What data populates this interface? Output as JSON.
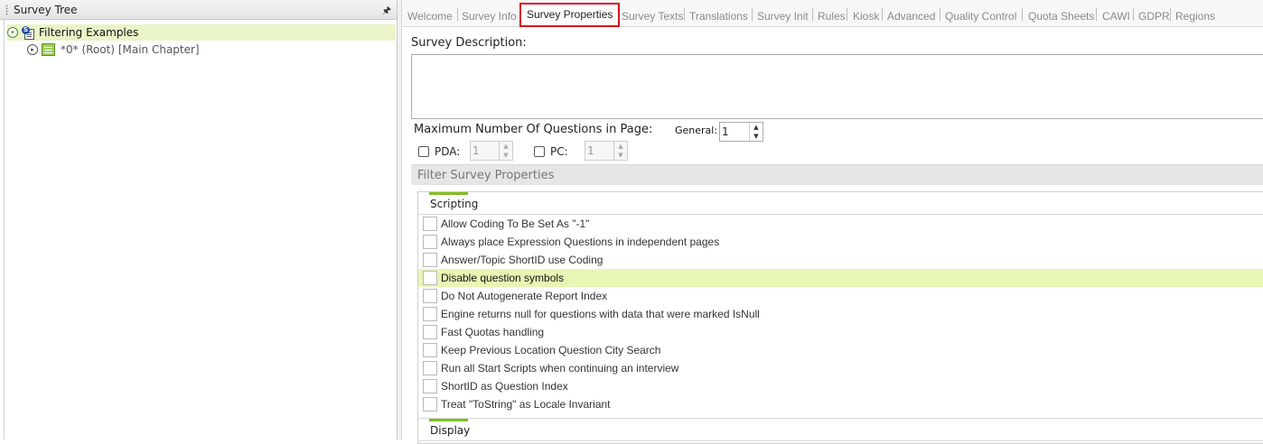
{
  "left_panel": {
    "title": "Survey Tree",
    "tree": [
      {
        "label": "Filtering Examples",
        "icon": "survey-icon",
        "expanded": true
      },
      {
        "label": "*0* (Root) [Main Chapter]",
        "icon": "chapter-icon",
        "expanded": false
      }
    ]
  },
  "tabs": [
    {
      "label": "Welcome"
    },
    {
      "label": "Survey Info"
    },
    {
      "label": "Survey Properties",
      "active": true
    },
    {
      "label": "Survey Texts"
    },
    {
      "label": "Translations"
    },
    {
      "label": "Survey Init"
    },
    {
      "label": "Rules"
    },
    {
      "label": "Kiosk"
    },
    {
      "label": "Advanced"
    },
    {
      "label": "Quality Control"
    },
    {
      "label": "Quota Sheets"
    },
    {
      "label": "CAWI"
    },
    {
      "label": "GDPR"
    },
    {
      "label": "Regions"
    }
  ],
  "description": {
    "label": "Survey Description:",
    "value": ""
  },
  "max_questions": {
    "label": "Maximum Number Of Questions in Page:",
    "general_label": "General:",
    "general_value": "1",
    "pda_label": "PDA:",
    "pda_value": "1",
    "pda_checked": false,
    "pc_label": "PC:",
    "pc_value": "1",
    "pc_checked": false
  },
  "filter_section": {
    "title": "Filter Survey Properties"
  },
  "groups": {
    "scripting": {
      "label": "Scripting",
      "items": [
        {
          "label": "Allow Coding To Be Set As \"-1\"",
          "checked": false
        },
        {
          "label": "Always place Expression Questions in independent pages",
          "checked": false
        },
        {
          "label": "Answer/Topic ShortID use Coding",
          "checked": false
        },
        {
          "label": "Disable question symbols",
          "checked": false,
          "highlighted": true
        },
        {
          "label": "Do Not Autogenerate Report Index",
          "checked": false
        },
        {
          "label": "Engine returns null for questions with data that were marked IsNull",
          "checked": false
        },
        {
          "label": "Fast Quotas handling",
          "checked": false
        },
        {
          "label": "Keep Previous Location Question City Search",
          "checked": false
        },
        {
          "label": "Run all Start Scripts when continuing an interview",
          "checked": false
        },
        {
          "label": "ShortID as Question Index",
          "checked": false
        },
        {
          "label": "Treat \"ToString\" as Locale Invariant",
          "checked": false
        }
      ]
    },
    "display": {
      "label": "Display"
    }
  },
  "colors": {
    "active_tab_outline": "#d6121e",
    "group_accent": "#7ec11c",
    "highlight_row": "#e8f6b4",
    "tree_selected": "#eaf4c8"
  }
}
